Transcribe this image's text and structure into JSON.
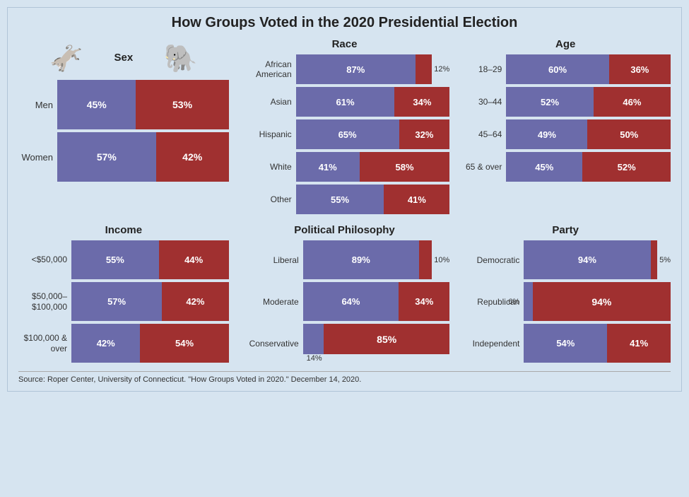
{
  "title": "How Groups Voted in the 2020 Presidential Election",
  "source": "Source: Roper Center, University of Connecticut. \"How Groups Voted in 2020.\" December 14, 2020.",
  "colors": {
    "dem": "#6b6baa",
    "rep": "#a03030"
  },
  "sex": {
    "title": "Sex",
    "rows": [
      {
        "label": "Men",
        "dem": 45,
        "rep": 53
      },
      {
        "label": "Women",
        "dem": 57,
        "rep": 42
      }
    ]
  },
  "race": {
    "title": "Race",
    "rows": [
      {
        "label": "African American",
        "dem": 87,
        "rep": null,
        "outer": "12%"
      },
      {
        "label": "Asian",
        "dem": 61,
        "rep": 34,
        "outer": null
      },
      {
        "label": "Hispanic",
        "dem": 65,
        "rep": 32,
        "outer": null
      },
      {
        "label": "White",
        "dem": 41,
        "rep": 58,
        "outer": null
      },
      {
        "label": "Other",
        "dem": 55,
        "rep": 41,
        "outer": null
      }
    ]
  },
  "age": {
    "title": "Age",
    "rows": [
      {
        "label": "18–29",
        "dem": 60,
        "rep": 36
      },
      {
        "label": "30–44",
        "dem": 52,
        "rep": 46
      },
      {
        "label": "45–64",
        "dem": 49,
        "rep": 50
      },
      {
        "label": "65 & over",
        "dem": 45,
        "rep": 52
      }
    ]
  },
  "income": {
    "title": "Income",
    "rows": [
      {
        "label": "<$50,000",
        "dem": 55,
        "rep": 44
      },
      {
        "label": "$50,000–$100,000",
        "dem": 57,
        "rep": 42
      },
      {
        "label": "$100,000 & over",
        "dem": 42,
        "rep": 54
      }
    ]
  },
  "polphil": {
    "title": "Political Philosophy",
    "rows": [
      {
        "label": "Liberal",
        "dem": 89,
        "rep": null,
        "outer": "10%"
      },
      {
        "label": "Moderate",
        "dem": 64,
        "rep": 34,
        "outer": null
      },
      {
        "label": "Conservative",
        "dem": null,
        "rep": 85,
        "outer": "14%"
      }
    ]
  },
  "party": {
    "title": "Party",
    "rows": [
      {
        "label": "Democratic",
        "dem": 94,
        "rep": null,
        "outer": "5%"
      },
      {
        "label": "Republican",
        "dem": null,
        "rep": 94,
        "outer": "6%"
      },
      {
        "label": "Independent",
        "dem": 54,
        "rep": 41,
        "outer": null
      }
    ]
  }
}
